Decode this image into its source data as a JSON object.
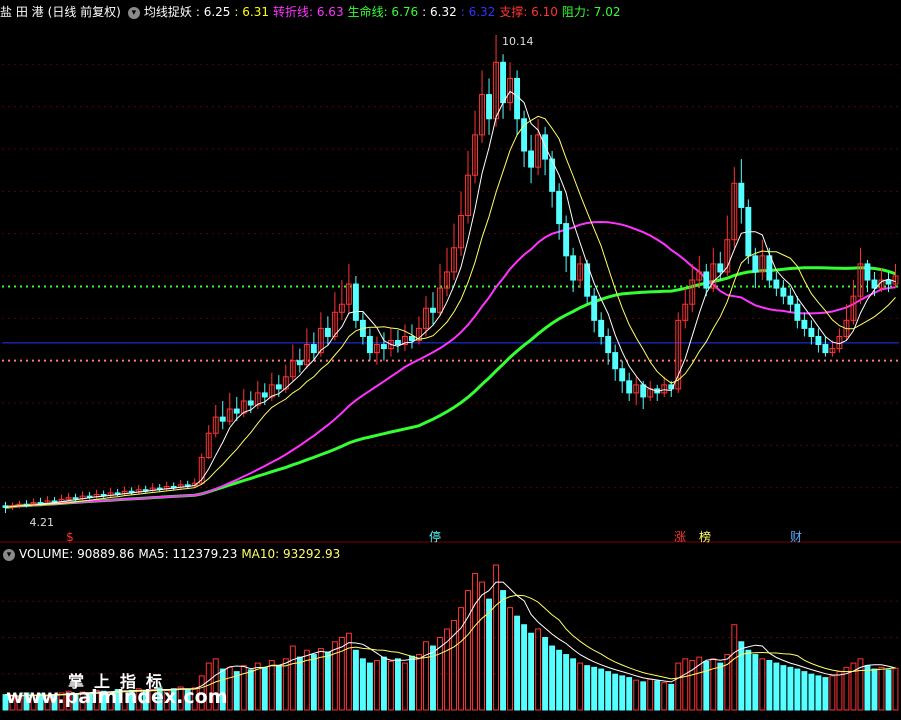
{
  "header": {
    "stock": "盐 田 港",
    "period": "(日线 前复权)",
    "indicator": "均线捉妖",
    "values": [
      {
        "label": ": 6.25",
        "color": "#ffffff"
      },
      {
        "label": ": 6.31",
        "color": "#ffff00"
      },
      {
        "label": "转折线: 6.63",
        "color": "#ff33ff"
      },
      {
        "label": "生命线: 6.76",
        "color": "#33ff33"
      },
      {
        "label": ": 6.32",
        "color": "#ffffff"
      },
      {
        "label": ": 6.32",
        "color": "#3333ff"
      },
      {
        "label": "支撑: 6.10",
        "color": "#ff3333"
      },
      {
        "label": "阻力: 7.02",
        "color": "#33ff33"
      }
    ]
  },
  "volume_header": {
    "volume": "VOLUME: 90889.86",
    "ma5": "MA5: 112379.23",
    "ma10": "MA10: 93292.93"
  },
  "annotations": {
    "high": "10.14",
    "low": "4.21",
    "markers": [
      "$",
      "停",
      "涨",
      "榜",
      "财"
    ]
  },
  "watermark": {
    "cn": "掌上指标",
    "url": "www.palmindex.com"
  },
  "colors": {
    "up": "#ff3333",
    "down": "#55ffff",
    "ma_fast": "#ffffff",
    "ma_slow": "#ffff66",
    "turn_line": "#ff33ff",
    "life_line": "#33ff33",
    "support": "#ff3333",
    "resistance": "#33ff33"
  },
  "chart_data": {
    "type": "candlestick",
    "price_range": [
      4.0,
      10.3
    ],
    "support": 6.1,
    "resistance": 7.02,
    "blue_level": 6.32,
    "high": 10.14,
    "low": 4.21,
    "candles": [
      [
        4.3,
        4.28,
        4.35,
        4.21
      ],
      [
        4.28,
        4.3,
        4.34,
        4.25
      ],
      [
        4.3,
        4.32,
        4.36,
        4.27
      ],
      [
        4.32,
        4.31,
        4.37,
        4.28
      ],
      [
        4.31,
        4.34,
        4.39,
        4.29
      ],
      [
        4.34,
        4.33,
        4.4,
        4.3
      ],
      [
        4.33,
        4.36,
        4.42,
        4.31
      ],
      [
        4.36,
        4.35,
        4.41,
        4.32
      ],
      [
        4.35,
        4.38,
        4.44,
        4.33
      ],
      [
        4.38,
        4.4,
        4.46,
        4.35
      ],
      [
        4.4,
        4.39,
        4.45,
        4.36
      ],
      [
        4.39,
        4.42,
        4.48,
        4.37
      ],
      [
        4.42,
        4.41,
        4.47,
        4.38
      ],
      [
        4.41,
        4.44,
        4.5,
        4.39
      ],
      [
        4.44,
        4.43,
        4.49,
        4.4
      ],
      [
        4.43,
        4.46,
        4.52,
        4.41
      ],
      [
        4.46,
        4.45,
        4.51,
        4.42
      ],
      [
        4.45,
        4.48,
        4.54,
        4.43
      ],
      [
        4.48,
        4.47,
        4.53,
        4.44
      ],
      [
        4.47,
        4.5,
        4.56,
        4.45
      ],
      [
        4.5,
        4.49,
        4.55,
        4.46
      ],
      [
        4.49,
        4.52,
        4.58,
        4.47
      ],
      [
        4.52,
        4.51,
        4.57,
        4.48
      ],
      [
        4.51,
        4.54,
        4.6,
        4.49
      ],
      [
        4.54,
        4.53,
        4.59,
        4.5
      ],
      [
        4.53,
        4.56,
        4.62,
        4.51
      ],
      [
        4.56,
        4.55,
        4.61,
        4.52
      ],
      [
        4.55,
        4.58,
        4.64,
        4.53
      ],
      [
        4.58,
        4.9,
        4.95,
        4.56
      ],
      [
        4.9,
        5.2,
        5.3,
        4.88
      ],
      [
        5.2,
        5.4,
        5.55,
        5.15
      ],
      [
        5.4,
        5.35,
        5.6,
        5.25
      ],
      [
        5.35,
        5.5,
        5.7,
        5.3
      ],
      [
        5.5,
        5.45,
        5.65,
        5.35
      ],
      [
        5.45,
        5.6,
        5.75,
        5.4
      ],
      [
        5.6,
        5.55,
        5.72,
        5.45
      ],
      [
        5.55,
        5.7,
        5.85,
        5.5
      ],
      [
        5.7,
        5.65,
        5.82,
        5.55
      ],
      [
        5.65,
        5.8,
        5.95,
        5.6
      ],
      [
        5.8,
        5.75,
        5.92,
        5.65
      ],
      [
        5.75,
        5.9,
        6.05,
        5.7
      ],
      [
        5.9,
        6.1,
        6.3,
        5.85
      ],
      [
        6.1,
        6.05,
        6.25,
        5.95
      ],
      [
        6.05,
        6.3,
        6.5,
        6.0
      ],
      [
        6.3,
        6.2,
        6.45,
        6.1
      ],
      [
        6.2,
        6.5,
        6.7,
        6.15
      ],
      [
        6.5,
        6.4,
        6.65,
        6.3
      ],
      [
        6.4,
        6.7,
        6.95,
        6.35
      ],
      [
        6.7,
        6.8,
        7.1,
        6.6
      ],
      [
        6.8,
        7.05,
        7.3,
        6.7
      ],
      [
        7.05,
        6.6,
        7.15,
        6.5
      ],
      [
        6.6,
        6.4,
        6.7,
        6.3
      ],
      [
        6.4,
        6.2,
        6.5,
        6.1
      ],
      [
        6.2,
        6.3,
        6.4,
        6.05
      ],
      [
        6.3,
        6.25,
        6.45,
        6.1
      ],
      [
        6.25,
        6.35,
        6.5,
        6.15
      ],
      [
        6.35,
        6.3,
        6.48,
        6.2
      ],
      [
        6.3,
        6.4,
        6.55,
        6.22
      ],
      [
        6.4,
        6.35,
        6.55,
        6.25
      ],
      [
        6.35,
        6.5,
        6.65,
        6.3
      ],
      [
        6.5,
        6.75,
        6.9,
        6.4
      ],
      [
        6.75,
        6.7,
        6.95,
        6.55
      ],
      [
        6.7,
        7.0,
        7.3,
        6.65
      ],
      [
        7.0,
        7.2,
        7.5,
        6.9
      ],
      [
        7.2,
        7.5,
        7.8,
        7.1
      ],
      [
        7.5,
        7.9,
        8.2,
        7.4
      ],
      [
        7.9,
        8.4,
        8.7,
        7.8
      ],
      [
        8.4,
        8.9,
        9.2,
        8.3
      ],
      [
        8.9,
        9.4,
        9.7,
        8.8
      ],
      [
        9.4,
        9.1,
        9.6,
        8.9
      ],
      [
        9.1,
        9.8,
        10.14,
        9.0
      ],
      [
        9.8,
        9.3,
        9.9,
        9.1
      ],
      [
        9.3,
        9.6,
        9.8,
        9.2
      ],
      [
        9.6,
        9.1,
        9.7,
        8.9
      ],
      [
        9.1,
        8.7,
        9.2,
        8.5
      ],
      [
        8.7,
        8.5,
        8.9,
        8.3
      ],
      [
        8.5,
        8.9,
        9.1,
        8.4
      ],
      [
        8.9,
        8.6,
        9.0,
        8.4
      ],
      [
        8.6,
        8.2,
        8.7,
        8.0
      ],
      [
        8.2,
        7.8,
        8.3,
        7.6
      ],
      [
        7.8,
        7.4,
        7.9,
        7.2
      ],
      [
        7.4,
        7.1,
        7.5,
        6.95
      ],
      [
        7.1,
        7.3,
        7.4,
        7.0
      ],
      [
        7.3,
        6.9,
        7.35,
        6.8
      ],
      [
        6.9,
        6.6,
        7.0,
        6.45
      ],
      [
        6.6,
        6.4,
        6.7,
        6.3
      ],
      [
        6.4,
        6.2,
        6.5,
        6.05
      ],
      [
        6.2,
        6.0,
        6.3,
        5.85
      ],
      [
        6.0,
        5.85,
        6.1,
        5.7
      ],
      [
        5.85,
        5.7,
        5.95,
        5.6
      ],
      [
        5.7,
        5.8,
        5.9,
        5.55
      ],
      [
        5.8,
        5.65,
        5.85,
        5.5
      ],
      [
        5.65,
        5.75,
        5.85,
        5.6
      ],
      [
        5.75,
        5.7,
        5.8,
        5.6
      ],
      [
        5.7,
        5.8,
        5.9,
        5.65
      ],
      [
        5.8,
        5.75,
        5.85,
        5.65
      ],
      [
        5.75,
        6.6,
        6.7,
        5.7
      ],
      [
        6.6,
        6.8,
        7.0,
        6.5
      ],
      [
        6.8,
        7.1,
        7.3,
        6.7
      ],
      [
        7.1,
        7.2,
        7.4,
        7.0
      ],
      [
        7.2,
        7.0,
        7.3,
        6.9
      ],
      [
        7.0,
        7.3,
        7.5,
        6.95
      ],
      [
        7.3,
        7.2,
        7.45,
        7.1
      ],
      [
        7.2,
        7.6,
        7.9,
        7.15
      ],
      [
        7.6,
        8.3,
        8.5,
        7.5
      ],
      [
        8.3,
        8.0,
        8.6,
        7.8
      ],
      [
        8.0,
        7.4,
        8.1,
        7.3
      ],
      [
        7.4,
        7.2,
        7.5,
        7.0
      ],
      [
        7.2,
        7.4,
        7.6,
        7.1
      ],
      [
        7.4,
        7.1,
        7.5,
        7.0
      ],
      [
        7.1,
        7.0,
        7.2,
        6.9
      ],
      [
        7.0,
        6.9,
        7.1,
        6.8
      ],
      [
        6.9,
        6.8,
        7.0,
        6.7
      ],
      [
        6.8,
        6.6,
        6.9,
        6.5
      ],
      [
        6.6,
        6.5,
        6.7,
        6.4
      ],
      [
        6.5,
        6.4,
        6.6,
        6.3
      ],
      [
        6.4,
        6.3,
        6.5,
        6.2
      ],
      [
        6.3,
        6.2,
        6.4,
        6.15
      ],
      [
        6.2,
        6.25,
        6.35,
        6.15
      ],
      [
        6.25,
        6.4,
        6.5,
        6.2
      ],
      [
        6.4,
        6.6,
        6.8,
        6.35
      ],
      [
        6.6,
        6.9,
        7.1,
        6.55
      ],
      [
        6.9,
        7.3,
        7.5,
        6.8
      ],
      [
        7.3,
        7.1,
        7.35,
        6.95
      ],
      [
        7.1,
        7.0,
        7.2,
        6.9
      ],
      [
        7.0,
        7.1,
        7.25,
        6.95
      ],
      [
        7.1,
        7.05,
        7.2,
        6.95
      ],
      [
        7.05,
        7.15,
        7.3,
        7.0
      ]
    ],
    "volume": [
      18,
      16,
      15,
      20,
      17,
      19,
      16,
      18,
      20,
      22,
      19,
      21,
      20,
      23,
      22,
      21,
      24,
      22,
      23,
      25,
      22,
      24,
      26,
      23,
      25,
      27,
      24,
      26,
      40,
      55,
      60,
      48,
      50,
      45,
      52,
      47,
      55,
      50,
      58,
      52,
      60,
      75,
      62,
      70,
      65,
      72,
      68,
      80,
      85,
      90,
      70,
      60,
      55,
      58,
      62,
      57,
      60,
      55,
      63,
      65,
      80,
      75,
      85,
      95,
      105,
      120,
      140,
      160,
      150,
      130,
      170,
      140,
      120,
      110,
      100,
      90,
      95,
      85,
      75,
      70,
      65,
      60,
      55,
      52,
      50,
      48,
      45,
      42,
      40,
      38,
      35,
      33,
      36,
      34,
      32,
      30,
      55,
      60,
      58,
      62,
      57,
      60,
      55,
      65,
      100,
      80,
      70,
      65,
      60,
      58,
      55,
      52,
      50,
      48,
      45,
      42,
      40,
      38,
      40,
      45,
      50,
      55,
      60,
      52,
      48,
      50,
      47,
      49
    ],
    "volume_range": [
      0,
      170
    ],
    "series": [
      {
        "name": "转折线",
        "value": 6.63
      },
      {
        "name": "生命线",
        "value": 6.76
      },
      {
        "name": "支撑",
        "value": 6.1
      },
      {
        "name": "阻力",
        "value": 7.02
      }
    ]
  }
}
